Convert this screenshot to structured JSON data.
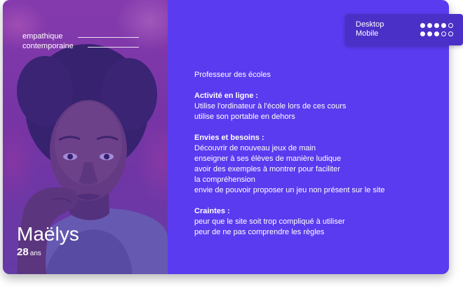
{
  "persona": {
    "name": "Maëlys",
    "age": "28",
    "age_unit": "ans",
    "traits": [
      "empathique",
      "contemporaine"
    ],
    "role": "Professeur des écoles"
  },
  "sections": [
    {
      "heading": "Activité en ligne :",
      "lines": [
        "Utilise l'ordinateur à l'école lors de ces cours",
        "utilise son portable en dehors"
      ]
    },
    {
      "heading": "Envies et besoins :",
      "lines": [
        "Découvrir de nouveau jeux de main",
        "enseigner à ses élèves de manière ludique",
        "avoir des exemples à montrer pour faciliter",
        "la compréhension",
        "envie de pouvoir proposer un jeu non présent sur le site"
      ]
    },
    {
      "heading": "Craintes :",
      "lines": [
        "peur que le site soit trop compliqué à utiliser",
        "peur de ne pas comprendre les règles"
      ]
    }
  ],
  "devices": [
    {
      "label": "Desktop",
      "rating": 4,
      "max": 5
    },
    {
      "label": "Mobile",
      "rating": 3,
      "max": 5
    }
  ],
  "colors": {
    "accent": "#5b3bef",
    "device_panel": "#4b30c8"
  }
}
